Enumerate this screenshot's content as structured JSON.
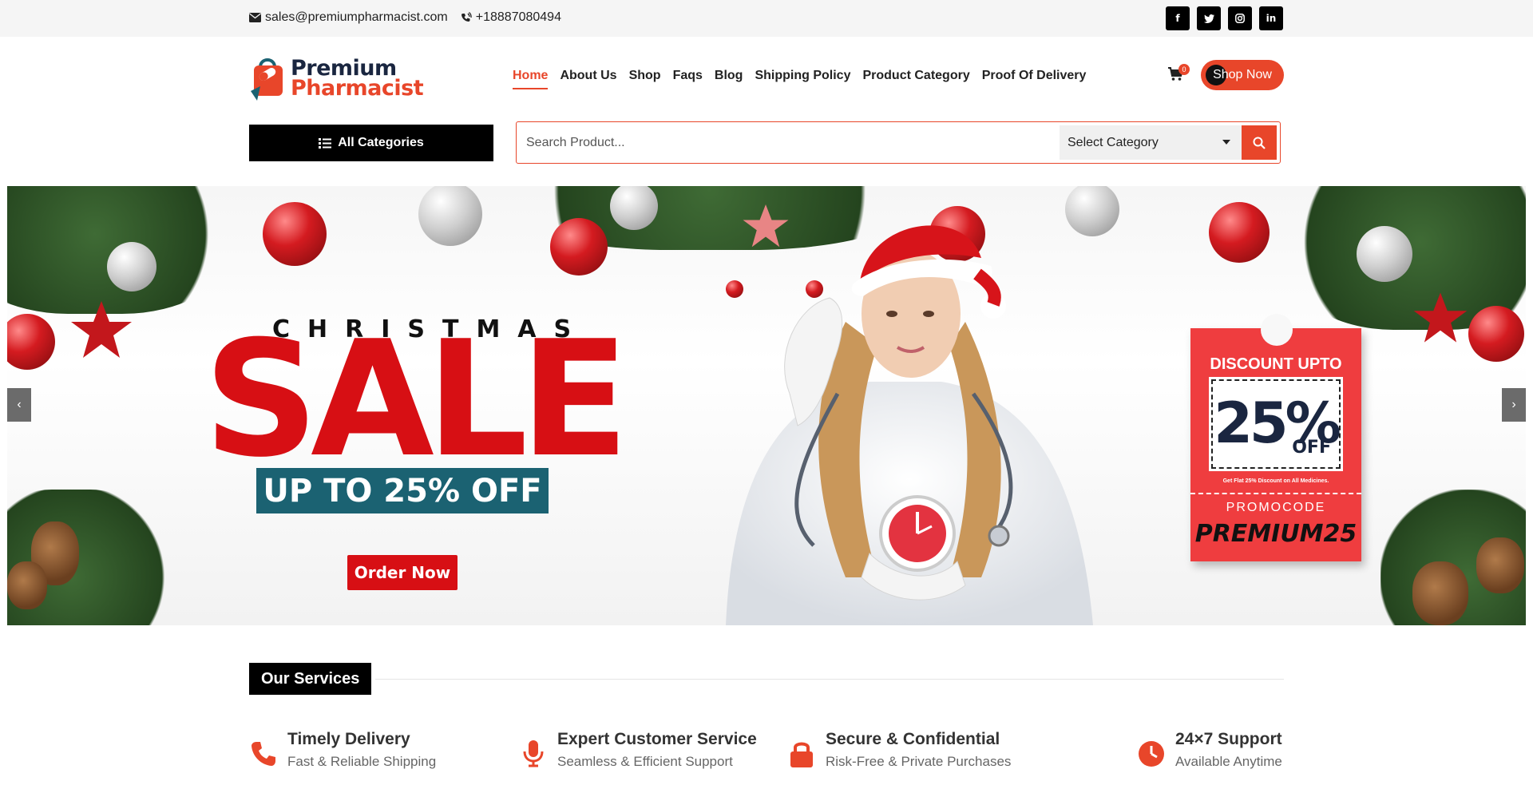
{
  "topbar": {
    "email": "sales@premiumpharmacist.com",
    "phone": "+18887080494",
    "social": [
      {
        "icon": "facebook-icon",
        "glyph": "f"
      },
      {
        "icon": "twitter-icon",
        "glyph": "t"
      },
      {
        "icon": "instagram-icon",
        "glyph": "◎"
      },
      {
        "icon": "linkedin-icon",
        "glyph": "in"
      }
    ]
  },
  "logo": {
    "line1": "Premium",
    "line2": "Pharmacist"
  },
  "nav": {
    "items": [
      "Home",
      "About Us",
      "Shop",
      "Faqs",
      "Blog",
      "Shipping Policy",
      "Product Category",
      "Proof Of Delivery"
    ],
    "active": "Home"
  },
  "cart": {
    "count": "0"
  },
  "header": {
    "shop_now": "Shop Now",
    "all_categories": "All Categories"
  },
  "search": {
    "placeholder": "Search Product...",
    "category_selected": "Select Category"
  },
  "hero": {
    "christmas": "CHRISTMAS",
    "sale": "SALE",
    "upto": "UP TO 25% OFF",
    "order_now": "Order Now",
    "coupon": {
      "discount_upto": "DISCOUNT UPTO",
      "percent": "25%",
      "off": "OFF",
      "fine_print": "Get Flat 25% Discount on All Medicines.",
      "promocode_label": "PROMOCODE",
      "promocode": "PREMIUM25"
    },
    "prev": "‹",
    "next": "›"
  },
  "services": {
    "title": "Our Services",
    "items": [
      {
        "title": "Timely Delivery",
        "subtitle": "Fast & Reliable Shipping",
        "icon": "phone-icon"
      },
      {
        "title": "Expert Customer Service",
        "subtitle": "Seamless & Efficient Support",
        "icon": "microphone-icon"
      },
      {
        "title": "Secure & Confidential",
        "subtitle": "Risk-Free & Private Purchases",
        "icon": "lock-icon"
      },
      {
        "title": "24×7 Support",
        "subtitle": "Available Anytime",
        "icon": "clock-icon"
      }
    ]
  },
  "colors": {
    "accent": "#e8462a",
    "sale_red": "#d70f14",
    "teal": "#1b6272",
    "navy": "#1a2640"
  }
}
